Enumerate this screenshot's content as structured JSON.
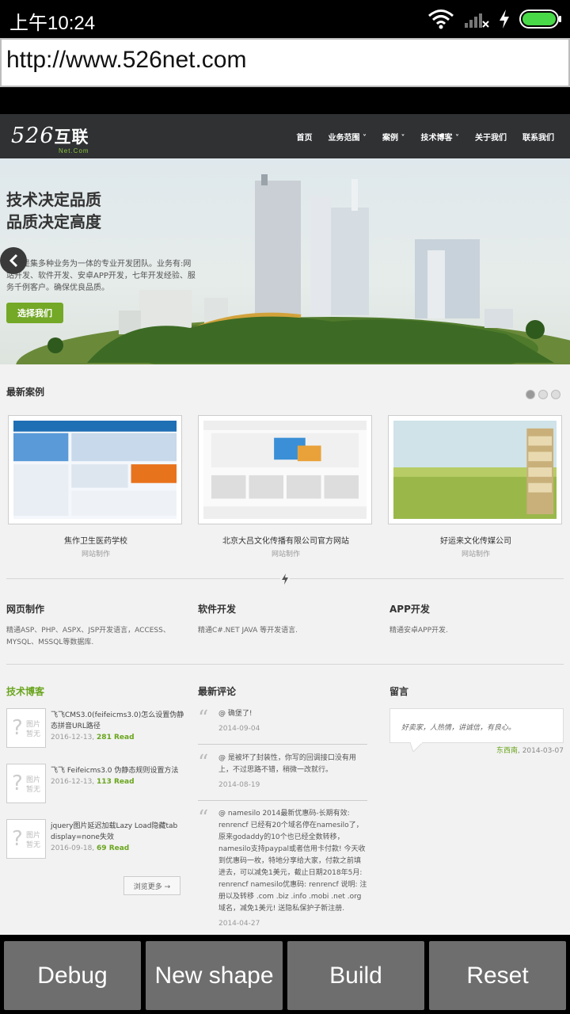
{
  "status_bar": {
    "time": "上午10:24"
  },
  "url_bar": {
    "value": "http://www.526net.com"
  },
  "site": {
    "logo": {
      "number": "526",
      "cn": "互联",
      "sub": "Net.Com"
    },
    "nav": [
      "首页",
      "业务范围 ˅",
      "案例 ˅",
      "技术博客 ˅",
      "关于我们",
      "联系我们"
    ],
    "hero": {
      "headline_1": "技术决定品质",
      "headline_2": "品质决定高度",
      "text": "互联是集多种业务为一体的专业开发团队。业务有:网站开发、软件开发、安卓APP开发，七年开发经验、服务千例客户。确保优良品质。",
      "button": "选择我们"
    },
    "cases_title": "最新案例",
    "cases": [
      {
        "name": "焦作卫生医药学校",
        "category": "网站制作"
      },
      {
        "name": "北京大吕文化传播有限公司官方网站",
        "category": "网站制作"
      },
      {
        "name": "好运来文化传媒公司",
        "category": "网站制作"
      }
    ],
    "services": [
      {
        "title": "网页制作",
        "desc": "精通ASP、PHP、ASPX、JSP开发语言，ACCESS、MYSQL、MSSQL等数据库."
      },
      {
        "title": "软件开发",
        "desc": "精通C#.NET JAVA 等开发语言."
      },
      {
        "title": "APP开发",
        "desc": "精通安卓APP开发."
      }
    ],
    "blog": {
      "title": "技术博客",
      "placeholder": "图片暂无",
      "items": [
        {
          "title": "飞飞CMS3.0(feifeicms3.0)怎么设置伪静态拼音URL路径",
          "date": "2016-12-13,",
          "reads": "281 Read"
        },
        {
          "title": "飞飞 Feifeicms3.0 伪静态规则设置方法",
          "date": "2016-12-13,",
          "reads": "113 Read"
        },
        {
          "title": "jquery图片延迟加载Lazy Load隐藏tab display=none失效",
          "date": "2016-09-18,",
          "reads": "69 Read"
        }
      ],
      "more": "浏览更多 →"
    },
    "comments": {
      "title": "最新评论",
      "items": [
        {
          "text": "@ 确堡了!",
          "date": "2014-09-04"
        },
        {
          "text": "@ 是被坏了封装性，你写的回调接口没有用上，不过思路不错，稍微一改就行。",
          "date": "2014-08-19"
        },
        {
          "text": "@ namesilo 2014最新优惠码-长期有效: renrencf 已经有20个域名停在namesilo了，原来godaddy的10个也已经全数转移，namesilo支持paypal或者信用卡付款! 今天收到优惠码一枚，特地分享给大家，付款之前填进去，可以减免1美元，截止日期2018年5月: renrencf namesilo优惠码: renrencf 说明: 注册以及转移 .com .biz .info .mobi .net .org域名，减免1美元! 送隐私保护子新注册.",
          "date": "2014-04-27"
        }
      ]
    },
    "guestbook": {
      "title": "留言",
      "text": "好卖家，人热情，讲诚信，有良心。",
      "author": "东西南",
      "date": ", 2014-03-07"
    }
  },
  "bottom_buttons": [
    "Debug",
    "New shape",
    "Build",
    "Reset"
  ]
}
